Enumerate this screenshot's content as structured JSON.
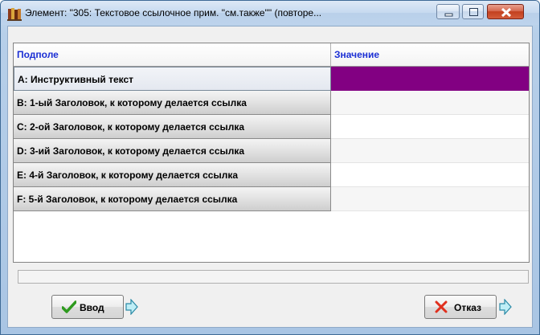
{
  "window": {
    "title": "Элемент: \"305: Текстовое ссылочное прим. \"см.также\"\" (повторе..."
  },
  "grid": {
    "columns": [
      "Подполе",
      "Значение"
    ],
    "rows": [
      {
        "label": "A: Инструктивный текст",
        "value": ""
      },
      {
        "label": "B: 1-ый Заголовок, к которому делается ссылка",
        "value": ""
      },
      {
        "label": "C: 2-ой Заголовок, к которому делается ссылка",
        "value": ""
      },
      {
        "label": "D: 3-ий Заголовок, к которому делается ссылка",
        "value": ""
      },
      {
        "label": "E: 4-й Заголовок, к которому делается ссылка",
        "value": ""
      },
      {
        "label": "F: 5-й Заголовок, к которому делается ссылка",
        "value": ""
      }
    ],
    "selected_row": 0
  },
  "status": {
    "text": ""
  },
  "buttons": {
    "ok_label": "Ввод",
    "cancel_label": "Отказ"
  },
  "colors": {
    "header_text": "#1b2fd4",
    "selected_value": "#820082",
    "titlebar": "#c6daf0"
  },
  "icons": {
    "app": "books-app-icon",
    "ok": "checkmark-icon",
    "cancel": "x-mark-icon",
    "arrow": "right-arrow-icon"
  }
}
